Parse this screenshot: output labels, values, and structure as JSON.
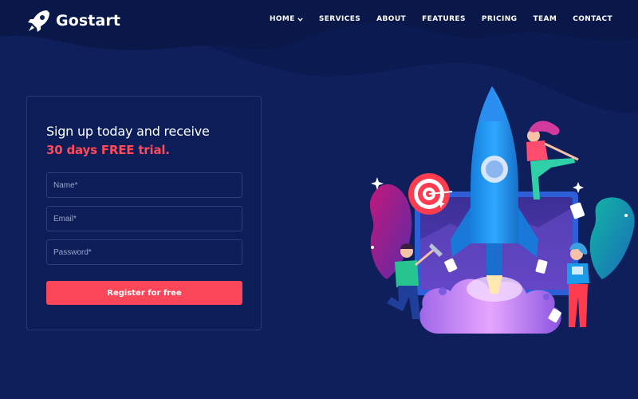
{
  "brand": {
    "name": "Gostart",
    "icon": "rocket-icon"
  },
  "nav": {
    "items": [
      {
        "label": "HOME",
        "icon": "chevron-down-icon"
      },
      {
        "label": "SERVICES"
      },
      {
        "label": "ABOUT"
      },
      {
        "label": "FEATURES"
      },
      {
        "label": "PRICING"
      },
      {
        "label": "TEAM"
      },
      {
        "label": "CONTACT"
      }
    ]
  },
  "signup": {
    "title": "Sign up today and receive",
    "highlight": "30 days FREE trial.",
    "name_placeholder": "Name*",
    "email_placeholder": "Email*",
    "password_placeholder": "Password*",
    "button_label": "Register for free"
  },
  "illustration": {
    "subject": "rocket-launch-illustration"
  },
  "colors": {
    "background": "#0e1f5c",
    "accent": "#f94659",
    "highlight_text": "#ff4a5a",
    "rocket": "#1e90e8"
  }
}
